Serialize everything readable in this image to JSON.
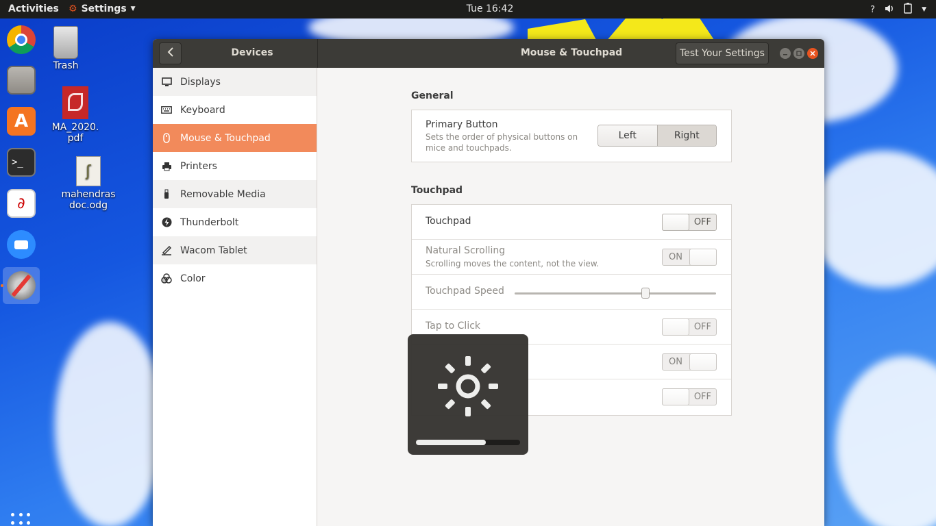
{
  "topbar": {
    "activities": "Activities",
    "app_menu": "Settings",
    "clock": "Tue 16:42",
    "help": "?"
  },
  "desktop": {
    "icons": [
      {
        "label": "Trash"
      },
      {
        "label": "MA_2020.\npdf"
      },
      {
        "label": "mahendras\ndoc.odg"
      }
    ]
  },
  "window": {
    "sidebar_title": "Devices",
    "title": "Mouse & Touchpad",
    "test_button": "Test Your Settings"
  },
  "sidebar": {
    "items": [
      {
        "label": "Displays",
        "icon": "display-icon"
      },
      {
        "label": "Keyboard",
        "icon": "keyboard-icon"
      },
      {
        "label": "Mouse & Touchpad",
        "icon": "mouse-icon",
        "selected": true
      },
      {
        "label": "Printers",
        "icon": "printer-icon"
      },
      {
        "label": "Removable Media",
        "icon": "usb-icon"
      },
      {
        "label": "Thunderbolt",
        "icon": "thunderbolt-icon"
      },
      {
        "label": "Wacom Tablet",
        "icon": "tablet-icon"
      },
      {
        "label": "Color",
        "icon": "color-icon"
      }
    ]
  },
  "general": {
    "title": "General",
    "primary_button": {
      "label": "Primary Button",
      "description_line1": "Sets the order of physical buttons on",
      "description_line2": "mice and touchpads.",
      "options": [
        "Left",
        "Right"
      ],
      "selected": "Right"
    }
  },
  "touchpad": {
    "title": "Touchpad",
    "touchpad": {
      "label": "Touchpad",
      "state": "OFF"
    },
    "natural_scrolling": {
      "label": "Natural Scrolling",
      "description": "Scrolling moves the content, not the view.",
      "state": "ON"
    },
    "speed": {
      "label": "Touchpad Speed",
      "value": 0.65
    },
    "tap_to_click": {
      "label": "Tap to Click",
      "state": "OFF"
    },
    "row5": {
      "state": "ON"
    },
    "row6": {
      "state": "OFF"
    }
  },
  "osd": {
    "icon": "brightness-icon",
    "level": 0.67
  },
  "colors": {
    "accent": "#f28a5b",
    "headerbar": "#3c3b37",
    "close": "#e95420"
  }
}
